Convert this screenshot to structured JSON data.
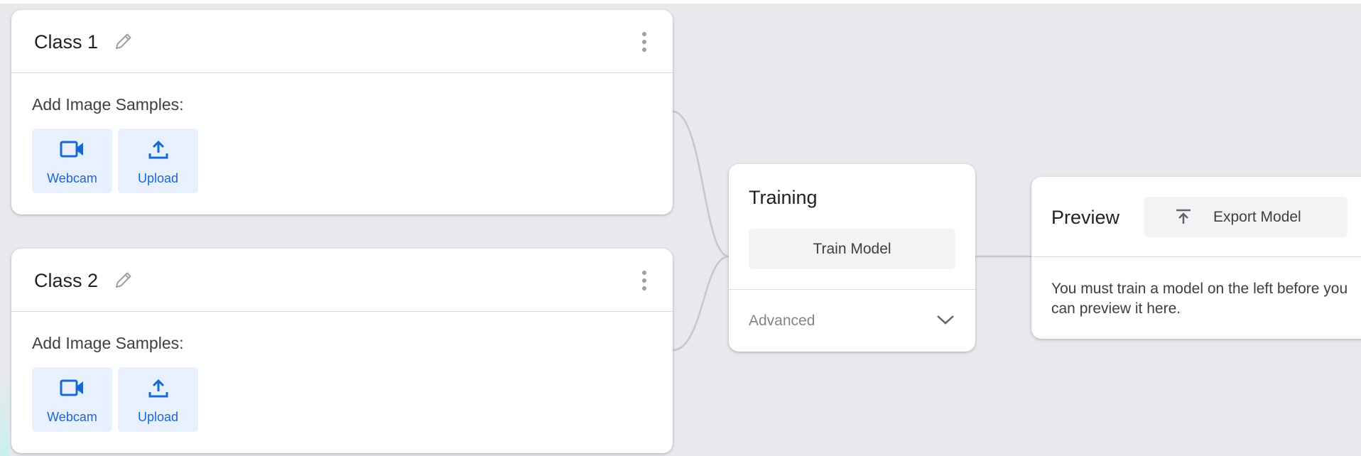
{
  "classes": [
    {
      "title": "Class 1",
      "samples_label": "Add Image Samples:",
      "webcam_label": "Webcam",
      "upload_label": "Upload"
    },
    {
      "title": "Class 2",
      "samples_label": "Add Image Samples:",
      "webcam_label": "Webcam",
      "upload_label": "Upload"
    }
  ],
  "training": {
    "title": "Training",
    "train_button": "Train Model",
    "advanced_label": "Advanced"
  },
  "preview": {
    "title": "Preview",
    "export_button": "Export Model",
    "message": "You must train a model on the left before you can preview it here."
  },
  "icons": {
    "edit": "pencil-icon",
    "menu": "more-vert-icon",
    "webcam": "videocam-icon",
    "upload": "upload-icon",
    "expand": "chevron-down-icon",
    "export": "export-icon"
  },
  "colors": {
    "accent": "#1967d2",
    "sample_button_bg": "#e8f0fe",
    "canvas_bg": "#e8e9ed",
    "card_bg": "#ffffff"
  }
}
